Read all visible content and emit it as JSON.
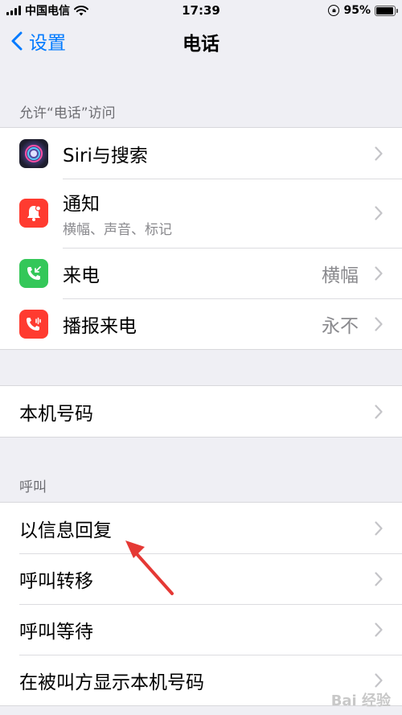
{
  "status_bar": {
    "carrier": "中国电信",
    "time": "17:39",
    "battery": "95%",
    "battery_level": 0.95
  },
  "nav": {
    "back_label": "设置",
    "title": "电话"
  },
  "section_allow": {
    "header": "允许“电话”访问",
    "items": [
      {
        "label": "Siri与搜索",
        "icon": "siri-icon",
        "color": "#2a2a3a"
      },
      {
        "label": "通知",
        "subtitle": "横幅、声音、标记",
        "icon": "bell-icon",
        "color": "#ff3b30"
      },
      {
        "label": "来电",
        "value": "横幅",
        "icon": "incoming-call-icon",
        "color": "#34c759"
      },
      {
        "label": "播报来电",
        "value": "永不",
        "icon": "announce-call-icon",
        "color": "#ff3b30"
      }
    ]
  },
  "section_number": {
    "items": [
      {
        "label": "本机号码"
      }
    ]
  },
  "section_calls": {
    "header": "呼叫",
    "items": [
      {
        "label": "以信息回复"
      },
      {
        "label": "呼叫转移"
      },
      {
        "label": "呼叫等待"
      },
      {
        "label": "在被叫方显示本机号码"
      }
    ]
  },
  "annotation": {
    "arrow_color": "#e53935"
  },
  "watermark": {
    "text": "Bai 经验"
  }
}
